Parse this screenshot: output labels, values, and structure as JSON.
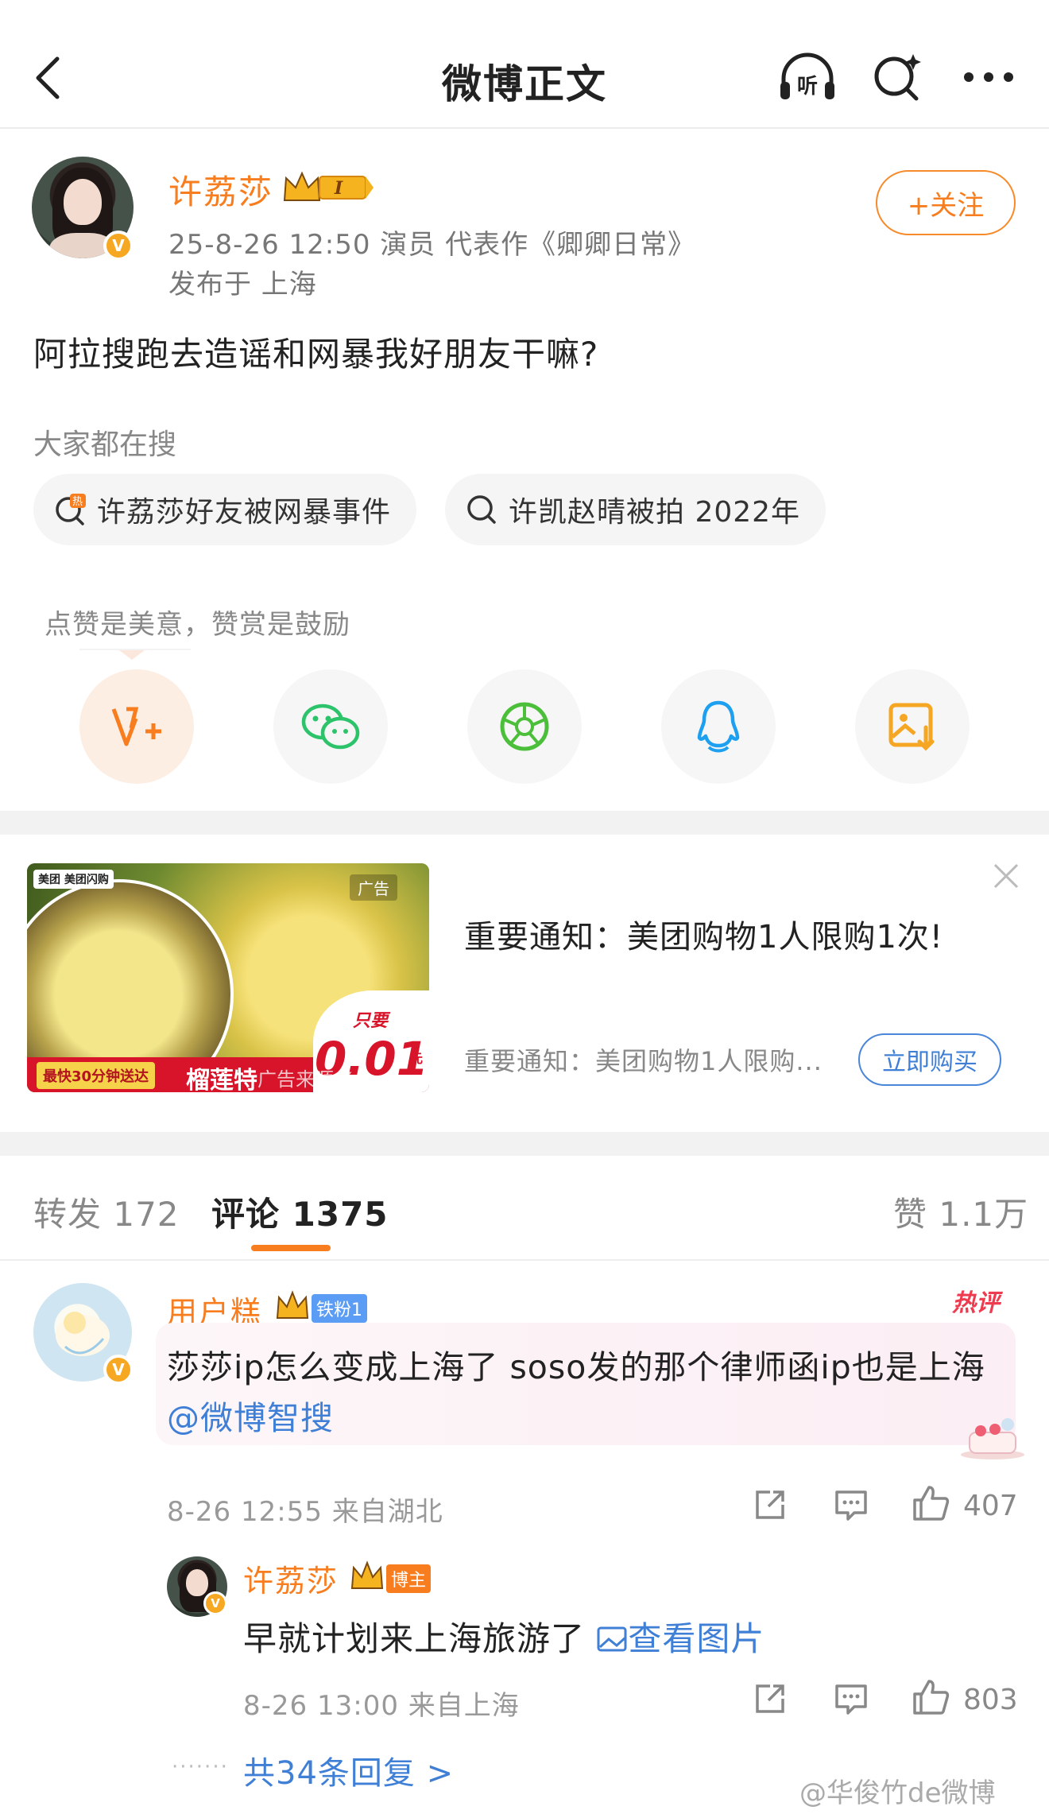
{
  "header": {
    "title": "微博正文"
  },
  "post": {
    "author": "许荔莎",
    "author_badge": "I",
    "meta": "25-8-26 12:50  演员 代表作《卿卿日常》",
    "location": "发布于 上海",
    "follow_label": "+关注",
    "text": "阿拉搜跑去造谣和网暴我好朋友干嘛?",
    "search_label": "大家都在搜",
    "chips": [
      "许荔莎好友被网暴事件",
      "许凯赵晴被拍 2022年"
    ],
    "tip_label": "点赞是美意，赞赏是鼓励"
  },
  "ad": {
    "title": "重要通知：美团购物1人限购1次!",
    "subtitle": "重要通知：美团购物1人限购...",
    "buy_label": "立即购买",
    "img_brand": "美团 美团闪购",
    "img_tag1": "最快30分钟送达",
    "img_tag2": "榴莲特",
    "img_price_label": "只要",
    "img_price": "0.01",
    "img_unit": "元",
    "img_ad": "广告",
    "img_source": "广告来源 Ycan"
  },
  "tabs": {
    "repost": "转发 172",
    "comments": "评论 1375",
    "likes": "赞 1.1万"
  },
  "comment1": {
    "name": "用户糕",
    "badge": "铁粉1",
    "hot": "热评",
    "text": "莎莎ip怎么变成上海了 soso发的那个律师函ip也是上海",
    "mention": "@微博智搜",
    "time": "8-26 12:55 来自湖北",
    "likes": "407"
  },
  "reply1": {
    "name": "许荔莎",
    "badge": "博主",
    "text": "早就计划来上海旅游了",
    "link": "查看图片",
    "time": "8-26 13:00 来自上海",
    "likes": "803"
  },
  "more_replies": "共34条回复 >",
  "watermark": "@华俊竹de微博",
  "colors": {
    "accent": "#f77d1e",
    "link": "#3f7fd6",
    "hot": "#ef3b4f"
  }
}
